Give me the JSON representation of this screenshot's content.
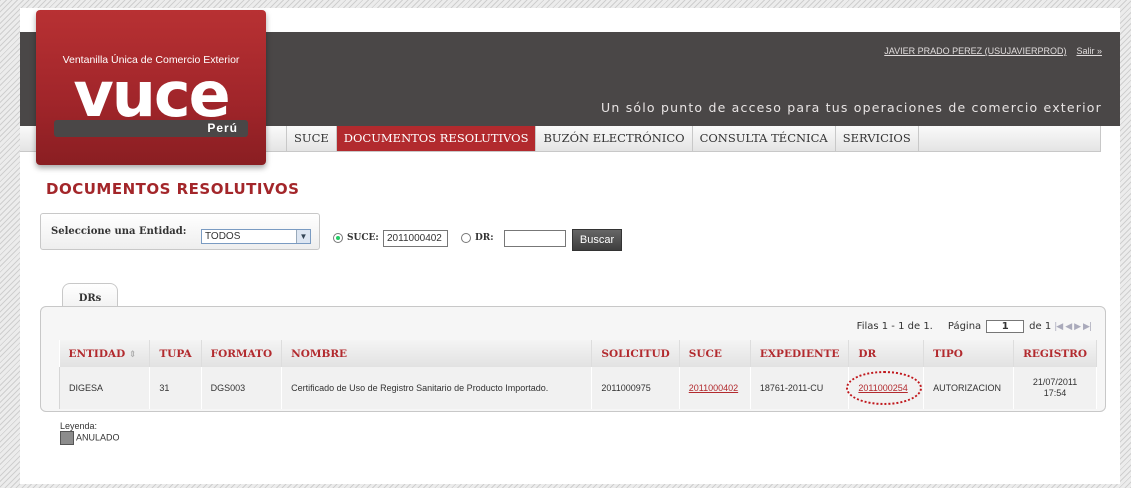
{
  "app": {
    "logo": {
      "subtitle": "Ventanilla Única de Comercio Exterior",
      "brand": "VUCE",
      "country": "Perú"
    },
    "user": {
      "name": "JAVIER PRADO PEREZ (USUJAVIERPROD)",
      "logout": "Salir »"
    },
    "tagline": "Un sólo punto de acceso para tus operaciones de comercio exterior"
  },
  "nav": {
    "items": [
      "SUCE",
      "DOCUMENTOS RESOLUTIVOS",
      "BUZÓN ELECTRÓNICO",
      "CONSULTA TÉCNICA",
      "SERVICIOS"
    ],
    "active": "DOCUMENTOS RESOLUTIVOS"
  },
  "page": {
    "title": "DOCUMENTOS RESOLUTIVOS"
  },
  "filter": {
    "entity_label": "Seleccione una Entidad:",
    "entity_value": "TODOS",
    "suce_label": "SUCE:",
    "suce_value": "2011000402",
    "dr_label": "DR:",
    "dr_value": "",
    "search_button": "Buscar",
    "selected_radio": "SUCE"
  },
  "tabs": [
    "DRs"
  ],
  "pager": {
    "rows_text": "Filas 1 - 1 de 1.",
    "page_label": "Página",
    "page_value": "1",
    "of_text": "de 1"
  },
  "table": {
    "columns": [
      "ENTIDAD",
      "TUPA",
      "FORMATO",
      "NOMBRE",
      "SOLICITUD",
      "SUCE",
      "EXPEDIENTE",
      "DR",
      "TIPO",
      "REGISTRO"
    ],
    "sort_icon": "sort-arrows-icon",
    "rows": [
      {
        "entidad": "DIGESA",
        "tupa": "31",
        "formato": "DGS003",
        "nombre": "Certificado de Uso de Registro Sanitario de Producto Importado.",
        "solicitud": "2011000975",
        "suce": "2011000402",
        "expediente": "18761-2011-CU",
        "dr": "2011000254",
        "tipo": "AUTORIZACION",
        "registro_date": "21/07/2011",
        "registro_time": "17:54"
      }
    ]
  },
  "legend": {
    "title": "Leyenda:",
    "items": [
      {
        "label": "ANULADO",
        "color": "#8c8c8c"
      }
    ]
  },
  "colors": {
    "accent": "#b22a2e",
    "header": "#4a4747"
  }
}
